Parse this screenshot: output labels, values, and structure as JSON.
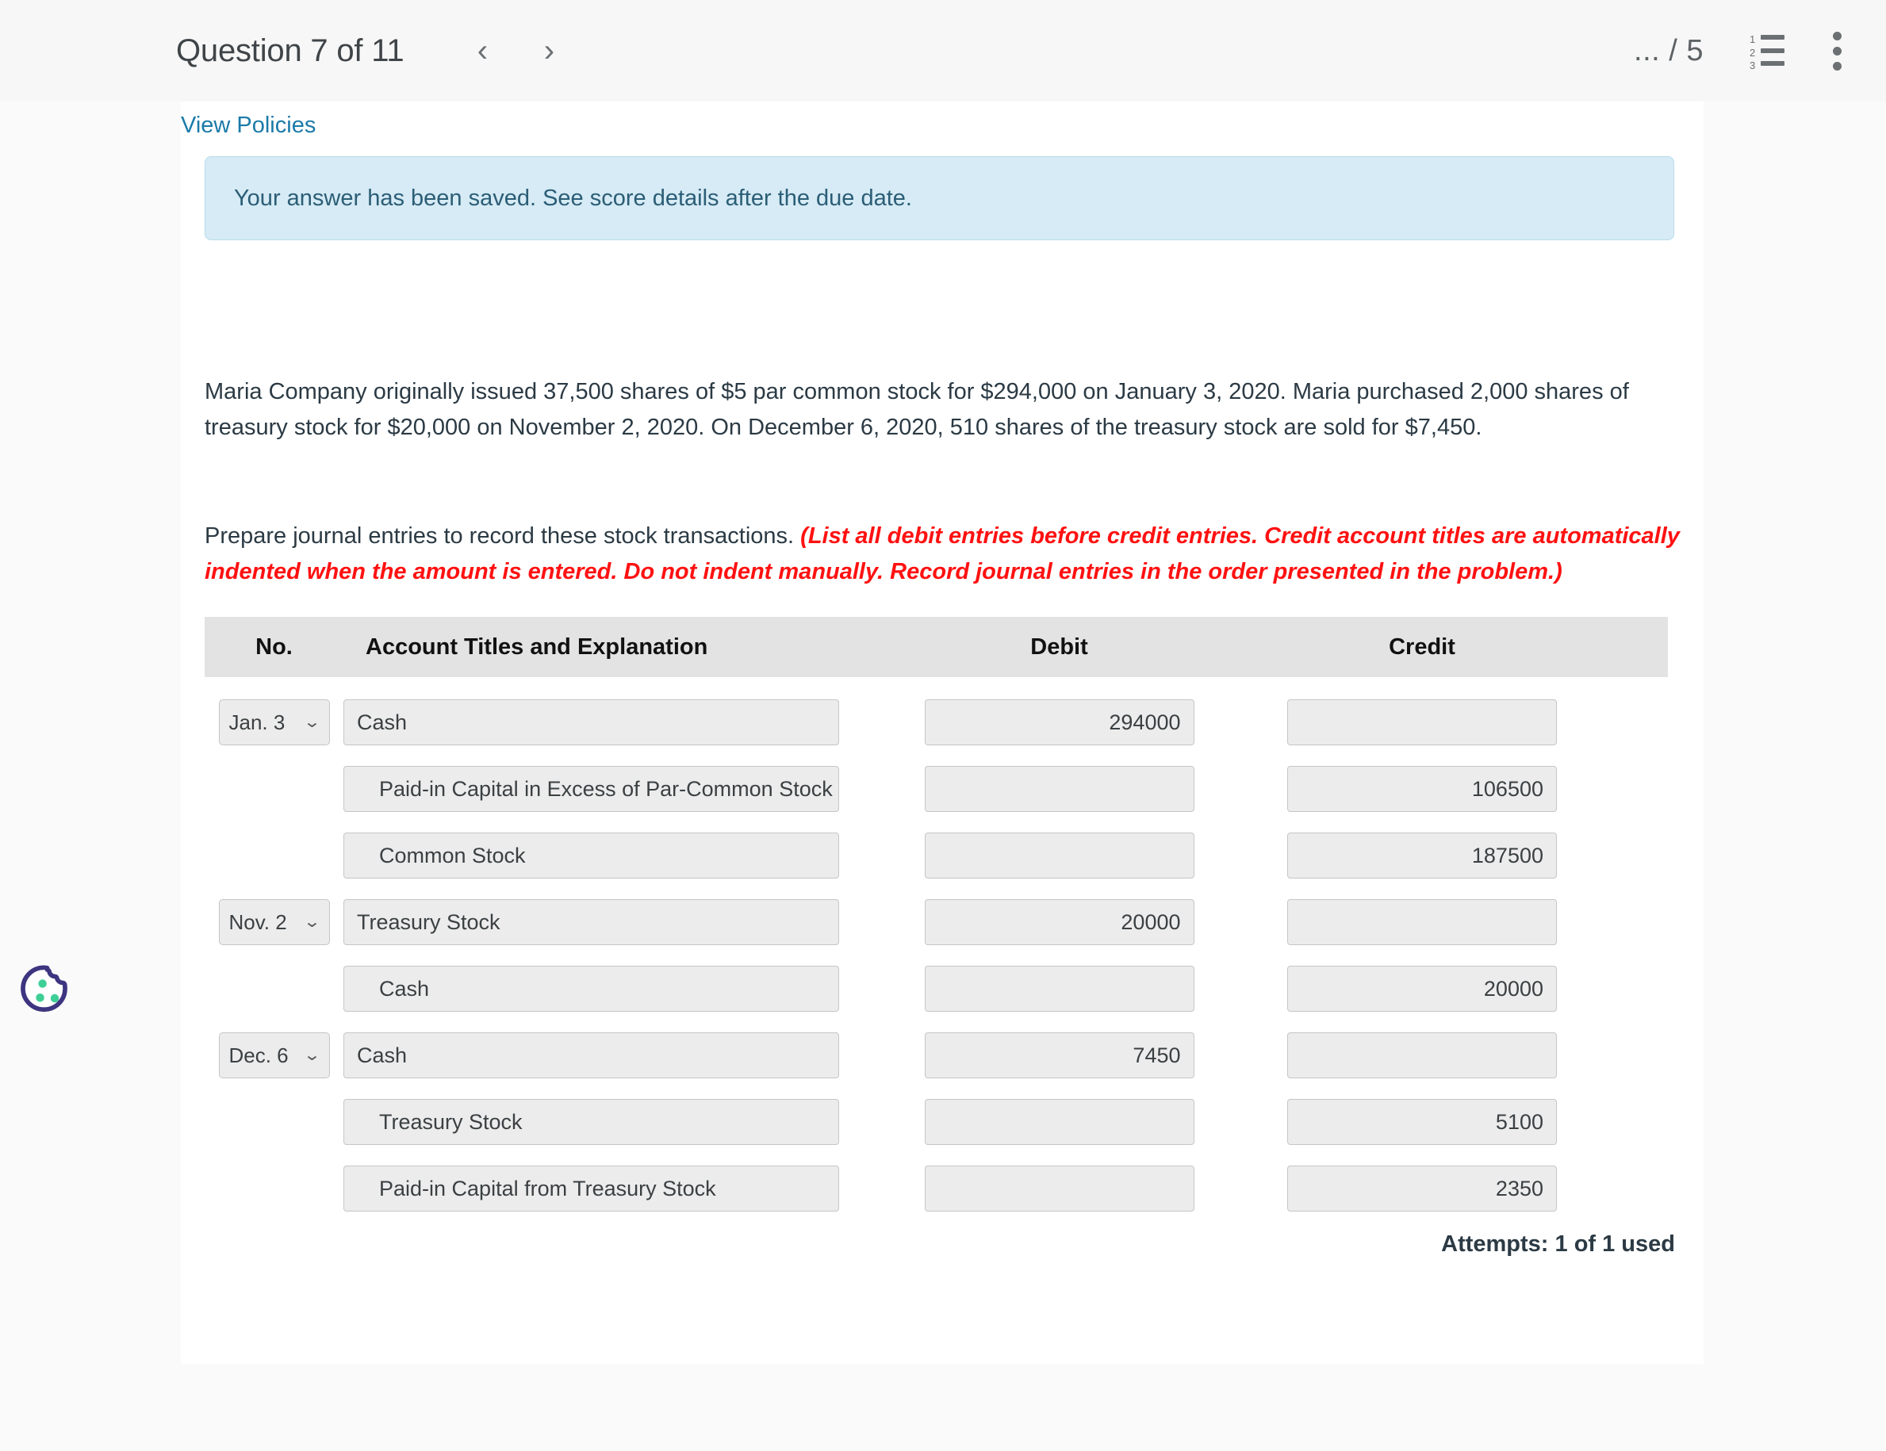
{
  "header": {
    "question_title": "Question 7 of 11",
    "prev_label": "‹",
    "next_label": "›",
    "score": "... / 5",
    "list_icon_numbers": [
      "1",
      "2",
      "3"
    ]
  },
  "content": {
    "view_policies": "View Policies",
    "alert_message": "Your answer has been saved. See score details after the due date.",
    "paragraph_1": "Maria Company originally issued 37,500 shares of $5 par common stock for $294,000 on January 3, 2020. Maria purchased 2,000 shares of treasury stock for $20,000 on November 2, 2020. On December 6, 2020, 510 shares of the treasury stock are sold for $7,450.",
    "paragraph_2_normal": "Prepare journal entries to record these stock transactions. ",
    "paragraph_2_red": "(List all debit entries before credit entries. Credit account titles are automatically indented when the amount is entered. Do not indent manually. Record journal entries in the order presented in the problem.)",
    "attempts": "Attempts: 1 of 1 used"
  },
  "table": {
    "columns": [
      "No.",
      "Account Titles and Explanation",
      "Debit",
      "Credit"
    ],
    "rows": [
      {
        "date": "Jan. 3",
        "account": "Cash",
        "indent": false,
        "debit": "294000",
        "credit": ""
      },
      {
        "date": "",
        "account": "Paid-in Capital in Excess of Par-Common Stock",
        "indent": true,
        "debit": "",
        "credit": "106500"
      },
      {
        "date": "",
        "account": "Common Stock",
        "indent": true,
        "debit": "",
        "credit": "187500"
      },
      {
        "date": "Nov. 2",
        "account": "Treasury Stock",
        "indent": false,
        "debit": "20000",
        "credit": ""
      },
      {
        "date": "",
        "account": "Cash",
        "indent": true,
        "debit": "",
        "credit": "20000"
      },
      {
        "date": "Dec. 6",
        "account": "Cash",
        "indent": false,
        "debit": "7450",
        "credit": ""
      },
      {
        "date": "",
        "account": "Treasury Stock",
        "indent": true,
        "debit": "",
        "credit": "5100"
      },
      {
        "date": "",
        "account": "Paid-in Capital from Treasury Stock",
        "indent": true,
        "debit": "",
        "credit": "2350"
      }
    ],
    "select_chevron": "⌄"
  },
  "cookie_widget": {
    "outline_color": "#3d3580",
    "dot_color": "#3ecf96"
  },
  "colors": {
    "link": "#1a7aa8",
    "alert_bg": "#d6ebf5",
    "alert_text": "#2b5d76",
    "red_instruction": "#ff1111",
    "table_header_bg": "#e3e3e3",
    "input_bg": "#ececec"
  }
}
